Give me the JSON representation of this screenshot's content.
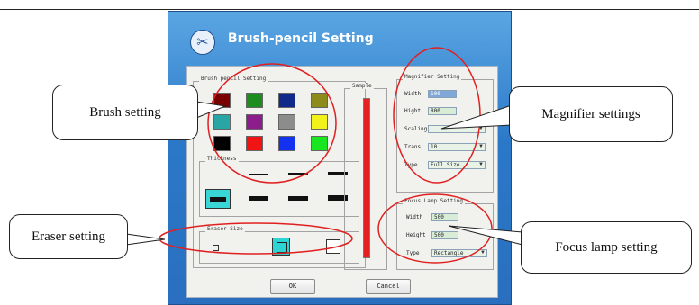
{
  "dialog": {
    "title": "Brush-pencil Setting",
    "icon": "brush-pencil-icon",
    "ok_label": "OK",
    "cancel_label": "Cancel"
  },
  "brush_group": {
    "title": "Brush pencil Setting",
    "colors": [
      "#7a0000",
      "#1f8c1f",
      "#102a8c",
      "#8c8c1a",
      "#2aa5a5",
      "#8c1e8c",
      "#8c8c8c",
      "#f2f21a",
      "#000000",
      "#f01414",
      "#1431f0",
      "#19e61e"
    ],
    "thickness_label": "Thickness",
    "eraser_label": "Eraser Size"
  },
  "sample": {
    "label": "Sample",
    "color": "#e62020"
  },
  "magnifier": {
    "title": "Magnifier Setting",
    "width_label": "Width",
    "width_value": "100",
    "height_label": "Hight",
    "height_value": "800",
    "scaling_label": "Scaling",
    "scaling_value": "",
    "trans_label": "Trans",
    "trans_value": "10",
    "type_label": "Type",
    "type_value": "Full Size"
  },
  "focus_lamp": {
    "title": "Focus Lamp Setting",
    "width_label": "Width",
    "width_value": "500",
    "height_label": "Height",
    "height_value": "500",
    "type_label": "Type",
    "type_value": "Rectangle"
  },
  "callouts": {
    "brush": "Brush setting",
    "magnifier": "Magnifier settings",
    "eraser": "Eraser setting",
    "focus": "Focus lamp setting"
  },
  "annotation_color": "#e02020"
}
